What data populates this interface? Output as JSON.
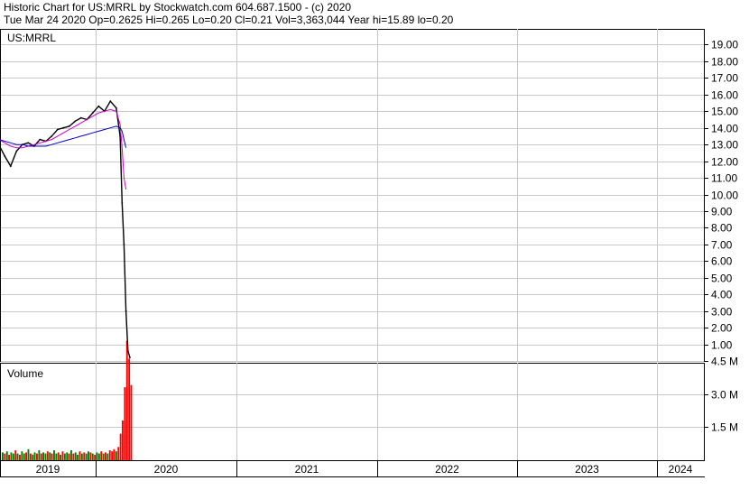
{
  "header": {
    "line1": "Historic Chart for US:MRRL by Stockwatch.com 604.687.1500 - (c) 2020",
    "line2": "Tue Mar 24 2020   Op=0.2625   Hi=0.265   Lo=0.20   Cl=0.21   Vol=3,363,044   Year hi=15.89   lo=0.20"
  },
  "chart_data": [
    {
      "type": "line",
      "title": "US:MRRL",
      "ylim": [
        0,
        19.8
      ],
      "y_ticks": [
        "1.00",
        "2.00",
        "3.00",
        "4.00",
        "5.00",
        "6.00",
        "7.00",
        "8.00",
        "9.00",
        "10.00",
        "11.00",
        "12.00",
        "13.00",
        "14.00",
        "15.00",
        "16.00",
        "17.00",
        "18.00",
        "19.00"
      ],
      "x_tick_labels": [
        "2019",
        "2020",
        "2021",
        "2022",
        "2023",
        "2024"
      ],
      "grid": true,
      "series_colors": {
        "price": "#000000",
        "ma_short": "#cc00cc",
        "ma_long": "#0000cc"
      },
      "x": [
        "2019-01",
        "2019-01",
        "2019-02",
        "2019-02",
        "2019-03",
        "2019-03",
        "2019-04",
        "2019-04",
        "2019-05",
        "2019-05",
        "2019-06",
        "2019-06",
        "2019-07",
        "2019-07",
        "2019-08",
        "2019-08",
        "2019-09",
        "2019-09",
        "2019-10",
        "2019-10",
        "2019-11",
        "2019-11",
        "2019-12",
        "2019-12",
        "2020-01",
        "2020-01",
        "2020-02",
        "2020-02",
        "2020-03",
        "2020-03",
        "2020-03",
        "2020-03",
        "2020-03",
        "2020-03"
      ],
      "series": [
        {
          "values": [
            14.0,
            13.5,
            12.7,
            13.2,
            13.6,
            13.2,
            13.5,
            13.0,
            12.3,
            11.7,
            12.6,
            13.0,
            13.1,
            12.9,
            13.3,
            13.2,
            13.5,
            13.9,
            14.0,
            14.1,
            14.4,
            14.6,
            14.5,
            14.9,
            15.3,
            15.0,
            15.6,
            15.2,
            13.5,
            9.5,
            7.0,
            3.0,
            0.6,
            0.21
          ]
        },
        {
          "values": [
            13.6,
            13.5,
            13.3,
            13.3,
            13.4,
            13.4,
            13.4,
            13.3,
            13.1,
            12.9,
            12.8,
            12.8,
            12.9,
            13.0,
            13.1,
            13.2,
            13.3,
            13.5,
            13.7,
            13.9,
            14.1,
            14.3,
            14.5,
            14.7,
            14.9,
            15.0,
            15.1,
            15.0,
            14.2,
            12.8,
            11.0,
            10.3
          ]
        },
        {
          "values": [
            13.7,
            13.6,
            13.5,
            13.4,
            13.4,
            13.3,
            13.3,
            13.3,
            13.2,
            13.1,
            13.0,
            13.0,
            12.9,
            12.9,
            12.9,
            12.9,
            13.0,
            13.1,
            13.2,
            13.3,
            13.4,
            13.5,
            13.6,
            13.7,
            13.8,
            13.9,
            14.0,
            14.1,
            14.0,
            13.8,
            13.3,
            12.8
          ]
        }
      ]
    },
    {
      "type": "bar",
      "title": "Volume",
      "y_ticks": [
        "1.5 M",
        "3.0 M",
        "4.5 M"
      ],
      "ylim": [
        0,
        5.4
      ],
      "bar_colors": {
        "up": "#008000",
        "down": "#ff0000"
      },
      "values": [
        0.35,
        0.3,
        0.4,
        0.25,
        0.35,
        0.3,
        0.45,
        0.3,
        0.25,
        0.4,
        0.3,
        0.35,
        0.5,
        0.3,
        0.25,
        0.35,
        0.3,
        0.45,
        0.3,
        0.35,
        0.3,
        0.4,
        0.35,
        0.3,
        0.45,
        0.3,
        0.35,
        0.25,
        0.4,
        0.3,
        0.35,
        0.3,
        0.45,
        0.3,
        0.35,
        0.25,
        0.4,
        0.3,
        0.35,
        0.3,
        0.4,
        0.35,
        0.3,
        0.25,
        0.35,
        0.3,
        0.4,
        0.3,
        0.35,
        0.3,
        0.45,
        0.4,
        0.5,
        0.4,
        0.6,
        1.2,
        1.8,
        3.3,
        5.4,
        4.6,
        3.4
      ],
      "up": [
        true,
        false,
        true,
        false,
        true,
        true,
        false,
        true,
        false,
        true,
        true,
        false,
        true,
        false,
        true,
        true,
        false,
        true,
        false,
        true,
        true,
        false,
        true,
        false,
        true,
        true,
        false,
        true,
        false,
        true,
        true,
        false,
        true,
        false,
        true,
        true,
        false,
        true,
        false,
        true,
        true,
        false,
        true,
        false,
        true,
        true,
        false,
        true,
        false,
        true,
        false,
        false,
        false,
        true,
        false,
        false,
        false,
        false,
        false,
        false,
        false
      ]
    }
  ]
}
